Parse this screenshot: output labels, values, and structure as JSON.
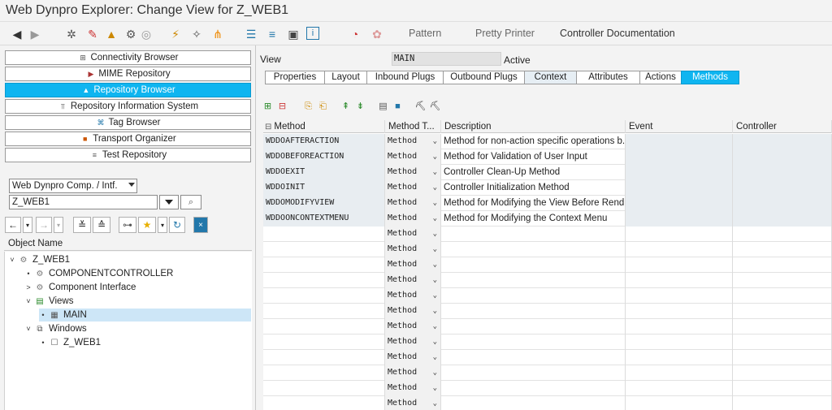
{
  "window": {
    "title": "Web Dynpro Explorer: Change View for Z_WEB1"
  },
  "toolbar": {
    "text_buttons": [
      "Pattern",
      "Pretty Printer",
      "Controller Documentation"
    ]
  },
  "nav_buttons": [
    {
      "label": "Connectivity Browser",
      "icon": "connectivity-icon",
      "active": false
    },
    {
      "label": "MIME Repository",
      "icon": "mime-icon",
      "active": false
    },
    {
      "label": "Repository Browser",
      "icon": "repository-icon",
      "active": true
    },
    {
      "label": "Repository Information System",
      "icon": "info-system-icon",
      "active": false
    },
    {
      "label": "Tag Browser",
      "icon": "tag-icon",
      "active": false
    },
    {
      "label": "Transport Organizer",
      "icon": "transport-icon",
      "active": false
    },
    {
      "label": "Test Repository",
      "icon": "test-icon",
      "active": false
    }
  ],
  "object_type": {
    "value": "Web Dynpro Comp. / Intf."
  },
  "object_name": {
    "value": "Z_WEB1"
  },
  "tree": {
    "header": "Object Name",
    "nodes": [
      {
        "label": "Z_WEB1",
        "expander": "˅",
        "icon": "component-icon",
        "level": 0
      },
      {
        "label": "COMPONENTCONTROLLER",
        "expander": "•",
        "icon": "controller-icon",
        "level": 1
      },
      {
        "label": "Component Interface",
        "expander": ">",
        "icon": "interface-icon",
        "level": 1
      },
      {
        "label": "Views",
        "expander": "˅",
        "icon": "views-icon",
        "level": 1
      },
      {
        "label": "MAIN",
        "expander": "•",
        "icon": "view-icon",
        "level": 2,
        "selected": true
      },
      {
        "label": "Windows",
        "expander": "˅",
        "icon": "windows-icon",
        "level": 1
      },
      {
        "label": "Z_WEB1",
        "expander": "•",
        "icon": "window-icon",
        "level": 2
      }
    ]
  },
  "view": {
    "label": "View",
    "name": "MAIN",
    "status": "Active"
  },
  "tabs": [
    {
      "label": "Properties",
      "state": "normal"
    },
    {
      "label": "Layout",
      "state": "normal"
    },
    {
      "label": "Inbound Plugs",
      "state": "normal"
    },
    {
      "label": "Outbound Plugs",
      "state": "normal"
    },
    {
      "label": "Context",
      "state": "shaded"
    },
    {
      "label": "Attributes",
      "state": "normal"
    },
    {
      "label": "Actions",
      "state": "normal"
    },
    {
      "label": "Methods",
      "state": "active"
    }
  ],
  "grid": {
    "headers": [
      "Method",
      "Method T...",
      "Description",
      "Event",
      "Controller"
    ],
    "rows": [
      {
        "method": "WDDOAFTERACTION",
        "type": "Method",
        "description": "Method for non-action specific operations b..."
      },
      {
        "method": "WDDOBEFOREACTION",
        "type": "Method",
        "description": "Method for Validation of User Input"
      },
      {
        "method": "WDDOEXIT",
        "type": "Method",
        "description": "Controller Clean-Up Method"
      },
      {
        "method": "WDDOINIT",
        "type": "Method",
        "description": "Controller Initialization Method"
      },
      {
        "method": "WDDOMODIFYVIEW",
        "type": "Method",
        "description": "Method for Modifying the View Before Rend..."
      },
      {
        "method": "WDDOONCONTEXTMENU",
        "type": "Method",
        "description": "Method for Modifying the Context Menu"
      },
      {
        "method": "",
        "type": "Method",
        "description": ""
      },
      {
        "method": "",
        "type": "Method",
        "description": ""
      },
      {
        "method": "",
        "type": "Method",
        "description": ""
      },
      {
        "method": "",
        "type": "Method",
        "description": ""
      },
      {
        "method": "",
        "type": "Method",
        "description": ""
      },
      {
        "method": "",
        "type": "Method",
        "description": ""
      },
      {
        "method": "",
        "type": "Method",
        "description": ""
      },
      {
        "method": "",
        "type": "Method",
        "description": ""
      },
      {
        "method": "",
        "type": "Method",
        "description": ""
      },
      {
        "method": "",
        "type": "Method",
        "description": ""
      },
      {
        "method": "",
        "type": "Method",
        "description": ""
      },
      {
        "method": "",
        "type": "Method",
        "description": ""
      }
    ]
  },
  "colors": {
    "accent": "#0fb5f0",
    "selection": "#cde6f7",
    "gridGray": "#e8edf1"
  }
}
